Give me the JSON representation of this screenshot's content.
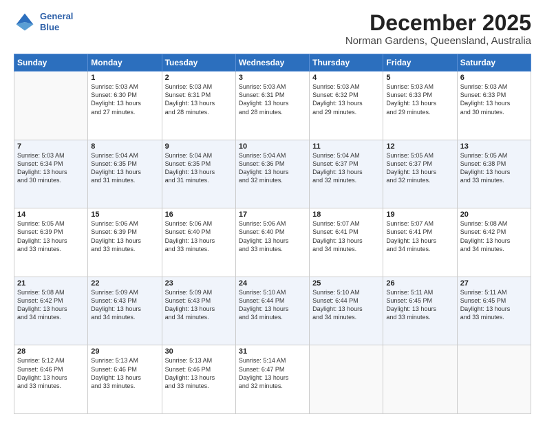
{
  "header": {
    "logo_line1": "General",
    "logo_line2": "Blue",
    "month": "December 2025",
    "location": "Norman Gardens, Queensland, Australia"
  },
  "weekdays": [
    "Sunday",
    "Monday",
    "Tuesday",
    "Wednesday",
    "Thursday",
    "Friday",
    "Saturday"
  ],
  "weeks": [
    [
      {
        "day": "",
        "sunrise": "",
        "sunset": "",
        "daylight": ""
      },
      {
        "day": "1",
        "sunrise": "Sunrise: 5:03 AM",
        "sunset": "Sunset: 6:30 PM",
        "daylight": "Daylight: 13 hours and 27 minutes."
      },
      {
        "day": "2",
        "sunrise": "Sunrise: 5:03 AM",
        "sunset": "Sunset: 6:31 PM",
        "daylight": "Daylight: 13 hours and 28 minutes."
      },
      {
        "day": "3",
        "sunrise": "Sunrise: 5:03 AM",
        "sunset": "Sunset: 6:31 PM",
        "daylight": "Daylight: 13 hours and 28 minutes."
      },
      {
        "day": "4",
        "sunrise": "Sunrise: 5:03 AM",
        "sunset": "Sunset: 6:32 PM",
        "daylight": "Daylight: 13 hours and 29 minutes."
      },
      {
        "day": "5",
        "sunrise": "Sunrise: 5:03 AM",
        "sunset": "Sunset: 6:33 PM",
        "daylight": "Daylight: 13 hours and 29 minutes."
      },
      {
        "day": "6",
        "sunrise": "Sunrise: 5:03 AM",
        "sunset": "Sunset: 6:33 PM",
        "daylight": "Daylight: 13 hours and 30 minutes."
      }
    ],
    [
      {
        "day": "7",
        "sunrise": "Sunrise: 5:03 AM",
        "sunset": "Sunset: 6:34 PM",
        "daylight": "Daylight: 13 hours and 30 minutes."
      },
      {
        "day": "8",
        "sunrise": "Sunrise: 5:04 AM",
        "sunset": "Sunset: 6:35 PM",
        "daylight": "Daylight: 13 hours and 31 minutes."
      },
      {
        "day": "9",
        "sunrise": "Sunrise: 5:04 AM",
        "sunset": "Sunset: 6:35 PM",
        "daylight": "Daylight: 13 hours and 31 minutes."
      },
      {
        "day": "10",
        "sunrise": "Sunrise: 5:04 AM",
        "sunset": "Sunset: 6:36 PM",
        "daylight": "Daylight: 13 hours and 32 minutes."
      },
      {
        "day": "11",
        "sunrise": "Sunrise: 5:04 AM",
        "sunset": "Sunset: 6:37 PM",
        "daylight": "Daylight: 13 hours and 32 minutes."
      },
      {
        "day": "12",
        "sunrise": "Sunrise: 5:05 AM",
        "sunset": "Sunset: 6:37 PM",
        "daylight": "Daylight: 13 hours and 32 minutes."
      },
      {
        "day": "13",
        "sunrise": "Sunrise: 5:05 AM",
        "sunset": "Sunset: 6:38 PM",
        "daylight": "Daylight: 13 hours and 33 minutes."
      }
    ],
    [
      {
        "day": "14",
        "sunrise": "Sunrise: 5:05 AM",
        "sunset": "Sunset: 6:39 PM",
        "daylight": "Daylight: 13 hours and 33 minutes."
      },
      {
        "day": "15",
        "sunrise": "Sunrise: 5:06 AM",
        "sunset": "Sunset: 6:39 PM",
        "daylight": "Daylight: 13 hours and 33 minutes."
      },
      {
        "day": "16",
        "sunrise": "Sunrise: 5:06 AM",
        "sunset": "Sunset: 6:40 PM",
        "daylight": "Daylight: 13 hours and 33 minutes."
      },
      {
        "day": "17",
        "sunrise": "Sunrise: 5:06 AM",
        "sunset": "Sunset: 6:40 PM",
        "daylight": "Daylight: 13 hours and 33 minutes."
      },
      {
        "day": "18",
        "sunrise": "Sunrise: 5:07 AM",
        "sunset": "Sunset: 6:41 PM",
        "daylight": "Daylight: 13 hours and 34 minutes."
      },
      {
        "day": "19",
        "sunrise": "Sunrise: 5:07 AM",
        "sunset": "Sunset: 6:41 PM",
        "daylight": "Daylight: 13 hours and 34 minutes."
      },
      {
        "day": "20",
        "sunrise": "Sunrise: 5:08 AM",
        "sunset": "Sunset: 6:42 PM",
        "daylight": "Daylight: 13 hours and 34 minutes."
      }
    ],
    [
      {
        "day": "21",
        "sunrise": "Sunrise: 5:08 AM",
        "sunset": "Sunset: 6:42 PM",
        "daylight": "Daylight: 13 hours and 34 minutes."
      },
      {
        "day": "22",
        "sunrise": "Sunrise: 5:09 AM",
        "sunset": "Sunset: 6:43 PM",
        "daylight": "Daylight: 13 hours and 34 minutes."
      },
      {
        "day": "23",
        "sunrise": "Sunrise: 5:09 AM",
        "sunset": "Sunset: 6:43 PM",
        "daylight": "Daylight: 13 hours and 34 minutes."
      },
      {
        "day": "24",
        "sunrise": "Sunrise: 5:10 AM",
        "sunset": "Sunset: 6:44 PM",
        "daylight": "Daylight: 13 hours and 34 minutes."
      },
      {
        "day": "25",
        "sunrise": "Sunrise: 5:10 AM",
        "sunset": "Sunset: 6:44 PM",
        "daylight": "Daylight: 13 hours and 34 minutes."
      },
      {
        "day": "26",
        "sunrise": "Sunrise: 5:11 AM",
        "sunset": "Sunset: 6:45 PM",
        "daylight": "Daylight: 13 hours and 33 minutes."
      },
      {
        "day": "27",
        "sunrise": "Sunrise: 5:11 AM",
        "sunset": "Sunset: 6:45 PM",
        "daylight": "Daylight: 13 hours and 33 minutes."
      }
    ],
    [
      {
        "day": "28",
        "sunrise": "Sunrise: 5:12 AM",
        "sunset": "Sunset: 6:46 PM",
        "daylight": "Daylight: 13 hours and 33 minutes."
      },
      {
        "day": "29",
        "sunrise": "Sunrise: 5:13 AM",
        "sunset": "Sunset: 6:46 PM",
        "daylight": "Daylight: 13 hours and 33 minutes."
      },
      {
        "day": "30",
        "sunrise": "Sunrise: 5:13 AM",
        "sunset": "Sunset: 6:46 PM",
        "daylight": "Daylight: 13 hours and 33 minutes."
      },
      {
        "day": "31",
        "sunrise": "Sunrise: 5:14 AM",
        "sunset": "Sunset: 6:47 PM",
        "daylight": "Daylight: 13 hours and 32 minutes."
      },
      {
        "day": "",
        "sunrise": "",
        "sunset": "",
        "daylight": ""
      },
      {
        "day": "",
        "sunrise": "",
        "sunset": "",
        "daylight": ""
      },
      {
        "day": "",
        "sunrise": "",
        "sunset": "",
        "daylight": ""
      }
    ]
  ]
}
